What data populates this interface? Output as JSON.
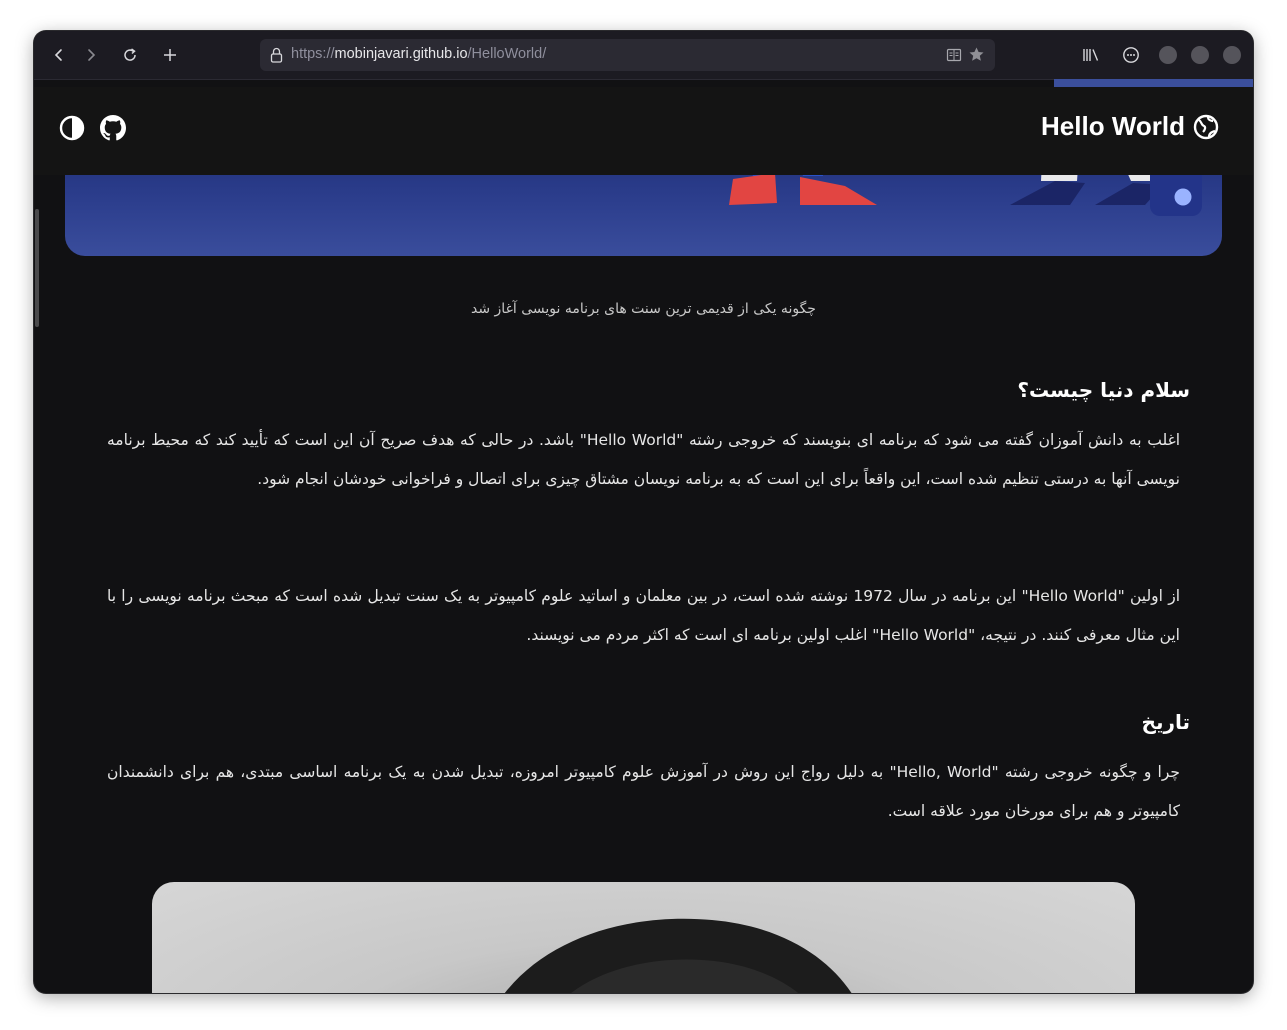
{
  "browser": {
    "url_scheme": "https://",
    "url_host": "mobinjavari.github.io",
    "url_path": "/HelloWorld/"
  },
  "site": {
    "title": "Hello World"
  },
  "article": {
    "caption": "چگونه یکی از قدیمی ترین سنت های برنامه نویسی آغاز شد",
    "section1_heading": "سلام دنیا چیست؟",
    "section1_p1": "اغلب به دانش آموزان گفته می شود که برنامه ای بنویسند که خروجی رشته \"Hello World\" باشد. در حالی که هدف صریح آن این است که تأیید کند که محیط برنامه نویسی آنها به درستی تنظیم شده است، این واقعاً برای این است که به برنامه نویسان مشتاق چیزی برای اتصال و فراخوانی خودشان انجام شود.",
    "section1_p2": "از اولین \"Hello World\" این برنامه در سال 1972 نوشته شده است، در بین معلمان و اساتید علوم کامپیوتر به یک سنت تبدیل شده است که مبحث برنامه نویسی را با این مثال معرفی کنند. در نتیجه، \"Hello World\" اغلب اولین برنامه ای است که اکثر مردم می نویسند.",
    "section2_heading": "تاریخ",
    "section2_p1": "چرا و چگونه خروجی رشته \"Hello, World\" به دلیل رواج این روش در آموزش علوم کامپیوتر امروزه، تبدیل شدن به یک برنامه اساسی مبتدی، هم برای دانشمندان کامپیوتر و هم برای مورخان مورد علاقه است."
  },
  "colors": {
    "page_bg": "#111113",
    "header_bg": "#141414",
    "accent": "#3b4f9c",
    "hero_gradient_top": "#1f2f7a",
    "hero_gradient_bottom": "#3a4d9c"
  },
  "icons": {
    "back": "back-arrow-icon",
    "forward": "forward-arrow-icon",
    "reload": "reload-icon",
    "new_tab": "plus-icon",
    "lock": "lock-icon",
    "reader": "reader-view-icon",
    "bookmark": "star-icon",
    "library": "library-icon",
    "account": "account-icon",
    "theme": "contrast-icon",
    "github": "github-icon",
    "globe": "globe-icon"
  }
}
